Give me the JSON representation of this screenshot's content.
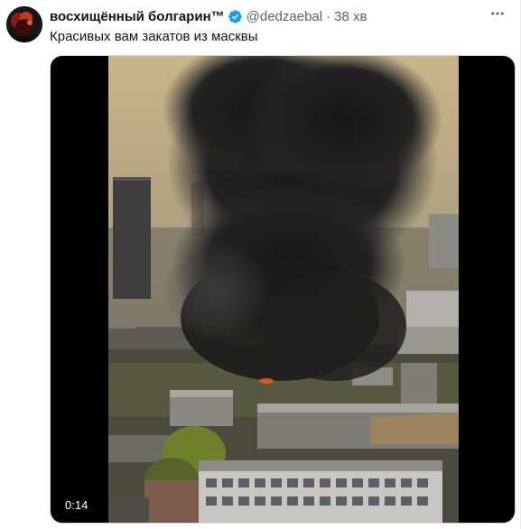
{
  "author": {
    "display_name": "восхищённый болгарин™",
    "handle": "@dedzaebal",
    "separator": "·",
    "time_ago": "38 хв"
  },
  "tweet": {
    "text": "Красивых вам закатов из масквы"
  },
  "media": {
    "video_time": "0:14"
  },
  "colors": {
    "verified_blue": "#1d9bf0",
    "secondary_text": "#536471",
    "primary_text": "#0f1419"
  },
  "icons": {
    "verified": "verified-badge-icon",
    "more": "more-options-icon"
  }
}
